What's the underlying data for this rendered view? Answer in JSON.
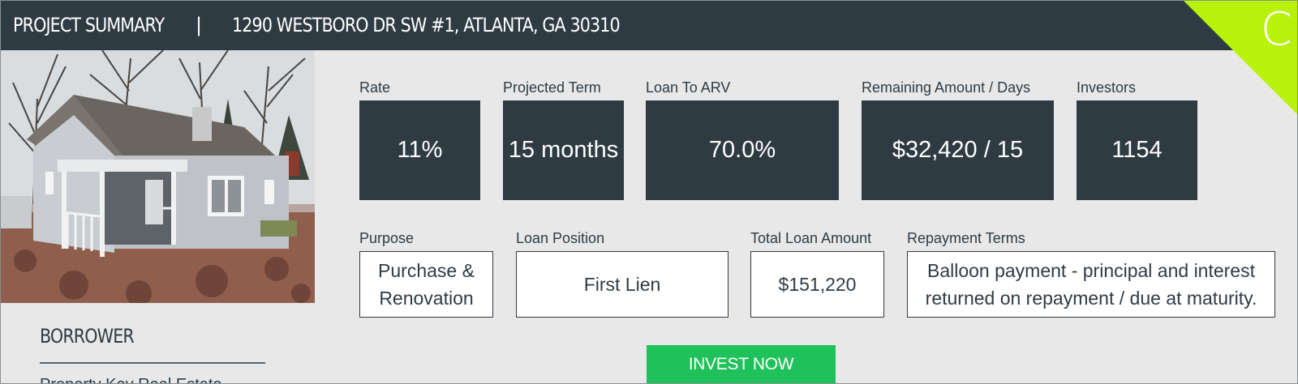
{
  "header": {
    "title": "PROJECT SUMMARY",
    "separator": "|",
    "address": "1290 WESTBORO DR SW #1, ATLANTA, GA 30310",
    "grade": "C",
    "grade_color": "#b8f20c"
  },
  "photo": {
    "icon": "house-photo"
  },
  "borrower": {
    "heading": "BORROWER",
    "name": "Property Key Real Estate"
  },
  "stats": [
    {
      "label": "Rate",
      "value": "11%"
    },
    {
      "label": "Projected Term",
      "value": "15 months"
    },
    {
      "label": "Loan To ARV",
      "value": "70.0%"
    },
    {
      "label": "Remaining Amount / Days",
      "value": "$32,420 / 15"
    },
    {
      "label": "Investors",
      "value": "1154"
    }
  ],
  "details": [
    {
      "label": "Purpose",
      "value_lines": [
        "Purchase &",
        "Renovation"
      ]
    },
    {
      "label": "Loan Position",
      "value_lines": [
        "First Lien"
      ]
    },
    {
      "label": "Total Loan Amount",
      "value_lines": [
        "$151,220"
      ]
    },
    {
      "label": "Repayment Terms",
      "value_lines": [
        "Balloon payment - principal and interest",
        "returned on repayment / due at maturity."
      ]
    }
  ],
  "actions": {
    "invest_label": "INVEST NOW"
  },
  "colors": {
    "header_bg": "#2f3b43",
    "page_bg": "#e8e8e8",
    "accent_green": "#1fc15a"
  }
}
